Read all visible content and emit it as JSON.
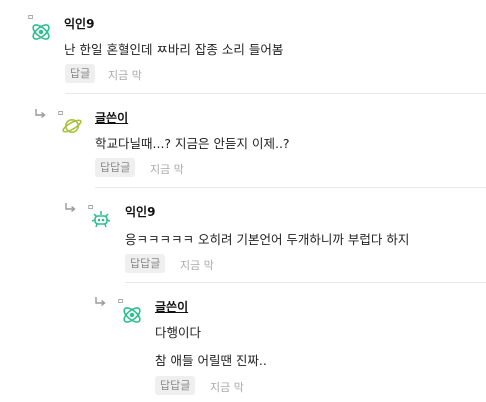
{
  "comments": [
    {
      "nickname": "익인9",
      "is_writer": false,
      "lines": [
        "난 한일 혼혈인데 ㅉ바리 잡종 소리 들어봄"
      ],
      "reply_label": "답글",
      "time": "지금 막",
      "avatar_icon": "orbit-icon",
      "avatar_color": "#2bbf8e"
    },
    {
      "nickname": "글쓴이",
      "is_writer": true,
      "lines": [
        "학교다닐때...? 지금은 안듣지 이제..?"
      ],
      "reply_label": "답답글",
      "time": "지금 막",
      "avatar_icon": "planet-icon",
      "avatar_color": "#a8c23a"
    },
    {
      "nickname": "익인9",
      "is_writer": false,
      "lines": [
        "응ㅋㅋㅋㅋㅋ 오히려 기본언어 두개하니까 부럽다 하지"
      ],
      "reply_label": "답답글",
      "time": "지금 막",
      "avatar_icon": "creature-icon",
      "avatar_color": "#2bbf8e"
    },
    {
      "nickname": "글쓴이",
      "is_writer": true,
      "lines": [
        "다행이다",
        "참 애들 어릴땐 진짜.."
      ],
      "reply_label": "답답글",
      "time": "지금 막",
      "avatar_icon": "orbit-icon",
      "avatar_color": "#2bbf8e"
    }
  ],
  "marker": "▫",
  "reply_arrow_icon": "reply-arrow-icon"
}
